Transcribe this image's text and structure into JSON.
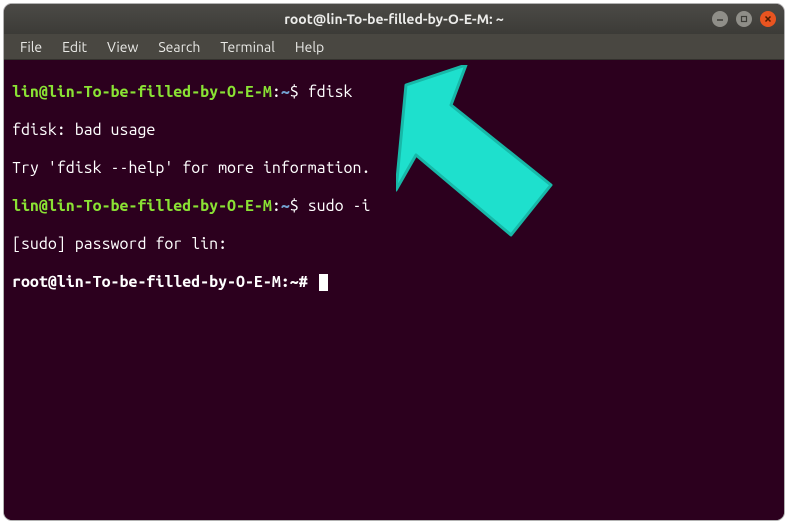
{
  "titlebar": {
    "title": "root@lin-To-be-filled-by-O-E-M: ~"
  },
  "menubar": {
    "items": [
      "File",
      "Edit",
      "View",
      "Search",
      "Terminal",
      "Help"
    ]
  },
  "terminal": {
    "lines": [
      {
        "user_host": "lin@lin-To-be-filled-by-O-E-M",
        "colon": ":",
        "path": "~",
        "symbol": "$ ",
        "command": "fdisk"
      },
      {
        "output": "fdisk: bad usage"
      },
      {
        "output": "Try 'fdisk --help' for more information."
      },
      {
        "user_host": "lin@lin-To-be-filled-by-O-E-M",
        "colon": ":",
        "path": "~",
        "symbol": "$ ",
        "command": "sudo -i"
      },
      {
        "output": "[sudo] password for lin:"
      },
      {
        "root_host": "root@lin-To-be-filled-by-O-E-M:~# ",
        "command": "",
        "cursor": true
      }
    ]
  },
  "colors": {
    "terminal_bg": "#2c001e",
    "prompt_green": "#8ae234",
    "prompt_blue": "#729fcf",
    "arrow": "#1ee0cd"
  }
}
